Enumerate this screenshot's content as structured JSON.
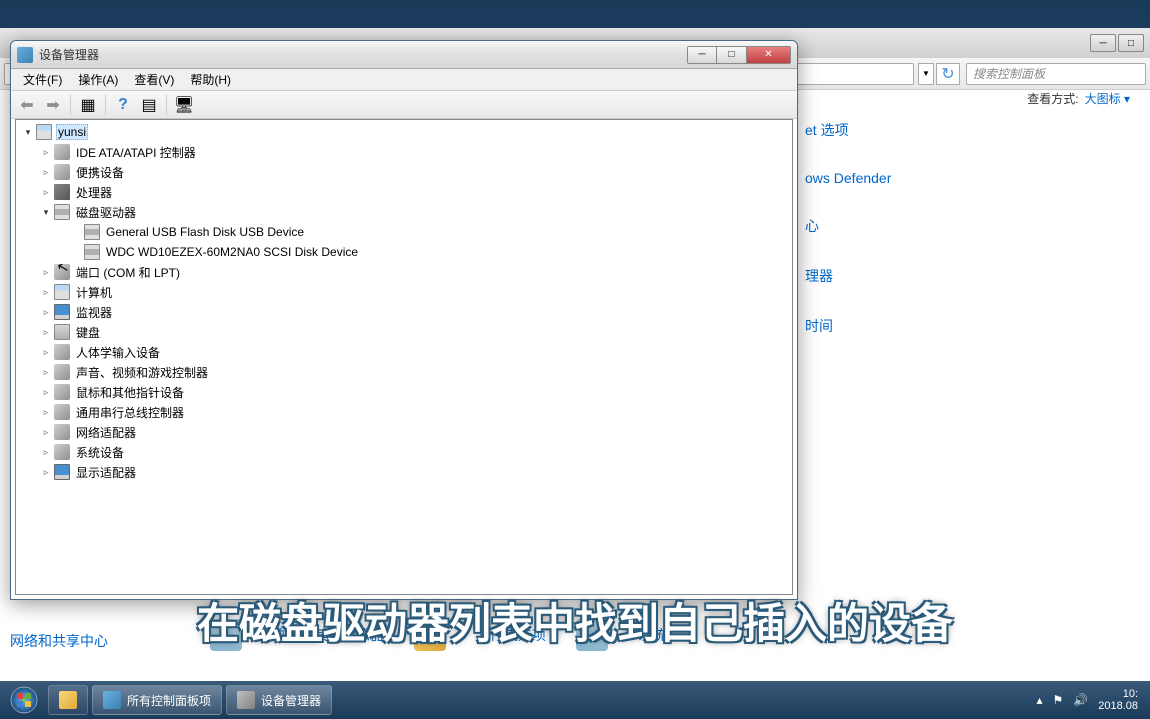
{
  "bg_window": {
    "search_placeholder": "搜索控制面板",
    "view_label": "查看方式:",
    "view_value": "大图标 ▾",
    "partial_items": [
      "et 选项",
      "ows Defender",
      "心",
      "理器",
      "时间"
    ],
    "bottom_left": "网络和共享中心",
    "bottom_row": [
      "位置和其他传感器",
      "文件夹选项",
      "系统"
    ]
  },
  "devmgr": {
    "title": "设备管理器",
    "menu": {
      "file": "文件(F)",
      "action": "操作(A)",
      "view": "查看(V)",
      "help": "帮助(H)"
    },
    "root": "yunsi",
    "categories": [
      {
        "label": "IDE ATA/ATAPI 控制器",
        "icon": "ico-generic"
      },
      {
        "label": "便携设备",
        "icon": "ico-generic"
      },
      {
        "label": "处理器",
        "icon": "ico-cpu"
      },
      {
        "label": "磁盘驱动器",
        "icon": "ico-disk",
        "expanded": true,
        "children": [
          "General USB Flash Disk USB Device",
          "WDC WD10EZEX-60M2NA0 SCSI Disk Device"
        ]
      },
      {
        "label": "端口 (COM 和 LPT)",
        "icon": "ico-generic"
      },
      {
        "label": "计算机",
        "icon": "ico-computer"
      },
      {
        "label": "监视器",
        "icon": "ico-monitor"
      },
      {
        "label": "键盘",
        "icon": "ico-keyboard"
      },
      {
        "label": "人体学输入设备",
        "icon": "ico-generic"
      },
      {
        "label": "声音、视频和游戏控制器",
        "icon": "ico-generic"
      },
      {
        "label": "鼠标和其他指针设备",
        "icon": "ico-generic"
      },
      {
        "label": "通用串行总线控制器",
        "icon": "ico-generic"
      },
      {
        "label": "网络适配器",
        "icon": "ico-generic"
      },
      {
        "label": "系统设备",
        "icon": "ico-generic"
      },
      {
        "label": "显示适配器",
        "icon": "ico-monitor"
      }
    ]
  },
  "taskbar": {
    "items": [
      "所有控制面板项",
      "设备管理器"
    ],
    "date": "2018.08",
    "time_partial": "10:"
  },
  "subtitle": "在磁盘驱动器列表中找到自己插入的设备"
}
